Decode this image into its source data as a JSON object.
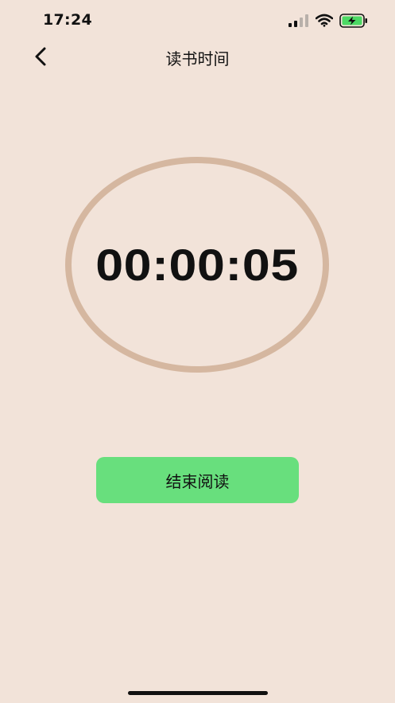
{
  "status_bar": {
    "time": "17:24",
    "signal_icon": "cellular-signal-icon",
    "wifi_icon": "wifi-icon",
    "battery_icon": "battery-charging-icon",
    "battery_color": "#4cd964"
  },
  "nav": {
    "back_icon": "chevron-left-icon",
    "title": "读书时间"
  },
  "timer": {
    "elapsed": "00:00:05",
    "ring_color": "#d5b7a0"
  },
  "actions": {
    "end_reading_label": "结束阅读",
    "button_color": "#68df7d"
  },
  "colors": {
    "background": "#f2e3d9"
  }
}
